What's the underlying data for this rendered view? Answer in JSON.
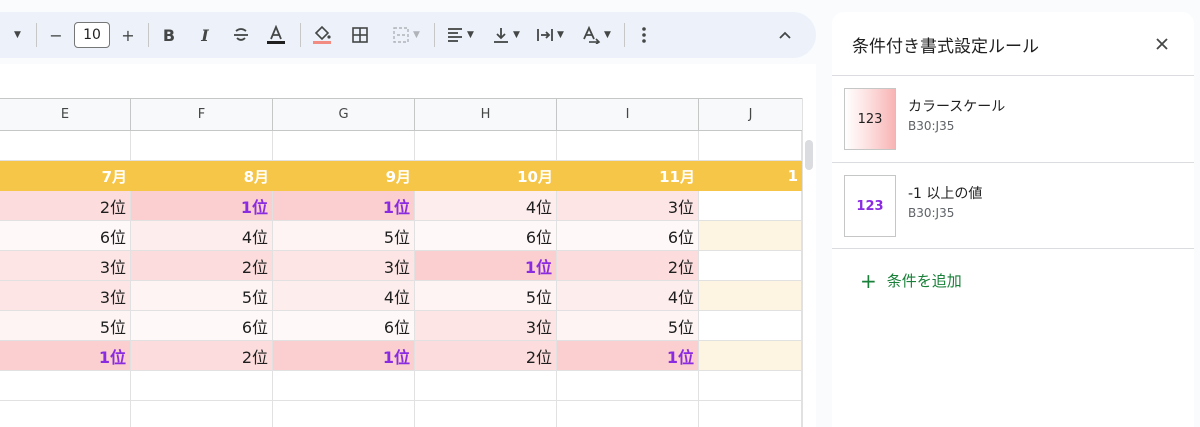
{
  "toolbar": {
    "font_size": "10",
    "minus_label": "−",
    "plus_label": "+",
    "bold_label": "B",
    "italic_label": "I"
  },
  "sheet": {
    "columns": [
      "E",
      "F",
      "G",
      "H",
      "I",
      "J"
    ],
    "header_row": [
      "7月",
      "8月",
      "9月",
      "10月",
      "11月",
      "1"
    ],
    "rows": [
      [
        "2位",
        "1位",
        "1位",
        "4位",
        "3位",
        ""
      ],
      [
        "6位",
        "4位",
        "5位",
        "6位",
        "6位",
        ""
      ],
      [
        "3位",
        "2位",
        "3位",
        "1位",
        "2位",
        ""
      ],
      [
        "3位",
        "5位",
        "4位",
        "5位",
        "4位",
        ""
      ],
      [
        "5位",
        "6位",
        "6位",
        "3位",
        "5位",
        ""
      ],
      [
        "1位",
        "2位",
        "1位",
        "2位",
        "1位",
        ""
      ]
    ],
    "colors": {
      "header": "#f6c648",
      "rank1": "#fbcfcf",
      "rank2": "#fcdcdc",
      "rank3": "#fde5e5",
      "rank4": "#fdeded",
      "rank5": "#fef4f4",
      "rank6": "#fff8f8",
      "col_j_band": "#fdf5e1",
      "first_text": "#8a2be2"
    }
  },
  "panel": {
    "title": "条件付き書式設定ルール",
    "rules": [
      {
        "preview": "123",
        "name": "カラースケール",
        "range": "B30:J35"
      },
      {
        "preview": "123",
        "name": "-1 以上の値",
        "range": "B30:J35"
      }
    ],
    "add_label": "条件を追加"
  }
}
